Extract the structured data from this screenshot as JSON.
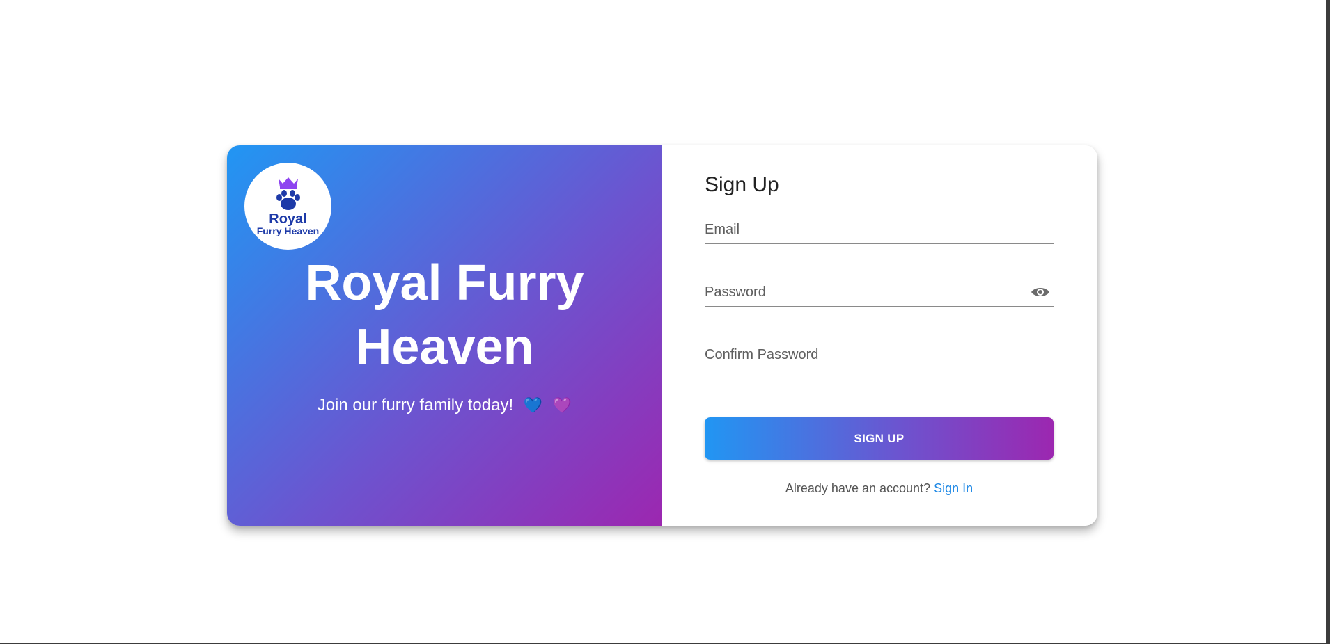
{
  "brand": {
    "logo_line1": "Royal",
    "logo_line2": "Furry Heaven",
    "logo_icon": "crowned-paw-icon"
  },
  "hero": {
    "title": "Royal Furry Heaven",
    "subtitle": "Join our furry family today!",
    "emoji_1": "💙",
    "emoji_2": "💜"
  },
  "form": {
    "title": "Sign Up",
    "email_placeholder": "Email",
    "password_placeholder": "Password",
    "confirm_placeholder": "Confirm Password",
    "toggle_icon": "eye-icon",
    "submit_label": "SIGN UP",
    "footer_prefix": "Already have an account?",
    "footer_link": "Sign In"
  },
  "colors": {
    "gradient_start": "#2196f3",
    "gradient_end": "#9c27b0",
    "link": "#1e88e5",
    "logo_text": "#1d3aa8"
  }
}
